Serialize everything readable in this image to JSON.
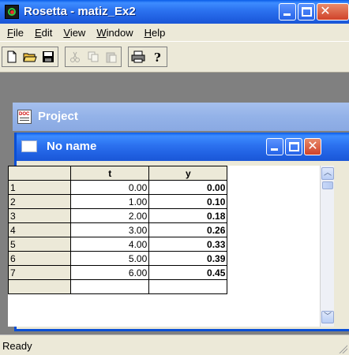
{
  "window": {
    "title": "Rosetta - matiz_Ex2",
    "minimize_glyph": "minimize-icon",
    "maximize_glyph": "maximize-icon",
    "close_glyph": "close-icon"
  },
  "menu": {
    "items": [
      {
        "label": "File",
        "accel": "F"
      },
      {
        "label": "Edit",
        "accel": "E"
      },
      {
        "label": "View",
        "accel": "V"
      },
      {
        "label": "Window",
        "accel": "W"
      },
      {
        "label": "Help",
        "accel": "H"
      }
    ]
  },
  "toolbar": {
    "buttons": [
      "new-document-icon",
      "open-folder-icon",
      "save-icon",
      "cut-icon",
      "copy-icon",
      "paste-icon",
      "print-icon",
      "help-icon"
    ]
  },
  "project": {
    "title": "Project"
  },
  "child_window": {
    "title": "No name"
  },
  "grid": {
    "columns": [
      "t",
      "y"
    ],
    "rows": [
      {
        "n": "1",
        "t": "0.00",
        "y": "0.00"
      },
      {
        "n": "2",
        "t": "1.00",
        "y": "0.10"
      },
      {
        "n": "3",
        "t": "2.00",
        "y": "0.18"
      },
      {
        "n": "4",
        "t": "3.00",
        "y": "0.26"
      },
      {
        "n": "5",
        "t": "4.00",
        "y": "0.33"
      },
      {
        "n": "6",
        "t": "5.00",
        "y": "0.39"
      },
      {
        "n": "7",
        "t": "6.00",
        "y": "0.45"
      }
    ]
  },
  "status": {
    "text": "Ready"
  },
  "colors": {
    "titlebar": "#2b71ef",
    "project_bar": "#93b2e8",
    "mdi_background": "#808080",
    "face": "#ece9d8"
  }
}
